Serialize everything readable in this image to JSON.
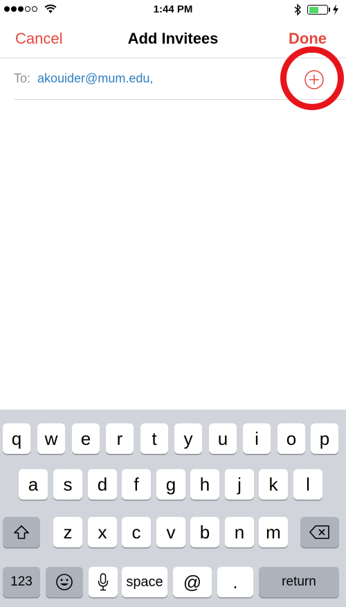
{
  "status": {
    "time": "1:44 PM",
    "signal_bars_filled": 3,
    "signal_bars_total": 5,
    "battery_level": 0.55,
    "battery_color": "#4cd964"
  },
  "nav": {
    "cancel": "Cancel",
    "title": "Add Invitees",
    "done": "Done",
    "accent_color": "#e4473d"
  },
  "to_field": {
    "label": "To:",
    "value": "akouider@mum.edu,",
    "add_icon": "plus-circle-icon"
  },
  "keyboard": {
    "row1": [
      "q",
      "w",
      "e",
      "r",
      "t",
      "y",
      "u",
      "i",
      "o",
      "p"
    ],
    "row2": [
      "a",
      "s",
      "d",
      "f",
      "g",
      "h",
      "j",
      "k",
      "l"
    ],
    "row3": [
      "z",
      "x",
      "c",
      "v",
      "b",
      "n",
      "m"
    ],
    "numbers": "123",
    "space": "space",
    "at": "@",
    "dot": ".",
    "return": "return",
    "shift_icon": "shift-icon",
    "delete_icon": "delete-icon",
    "emoji_icon": "emoji-icon",
    "mic_icon": "microphone-icon"
  }
}
